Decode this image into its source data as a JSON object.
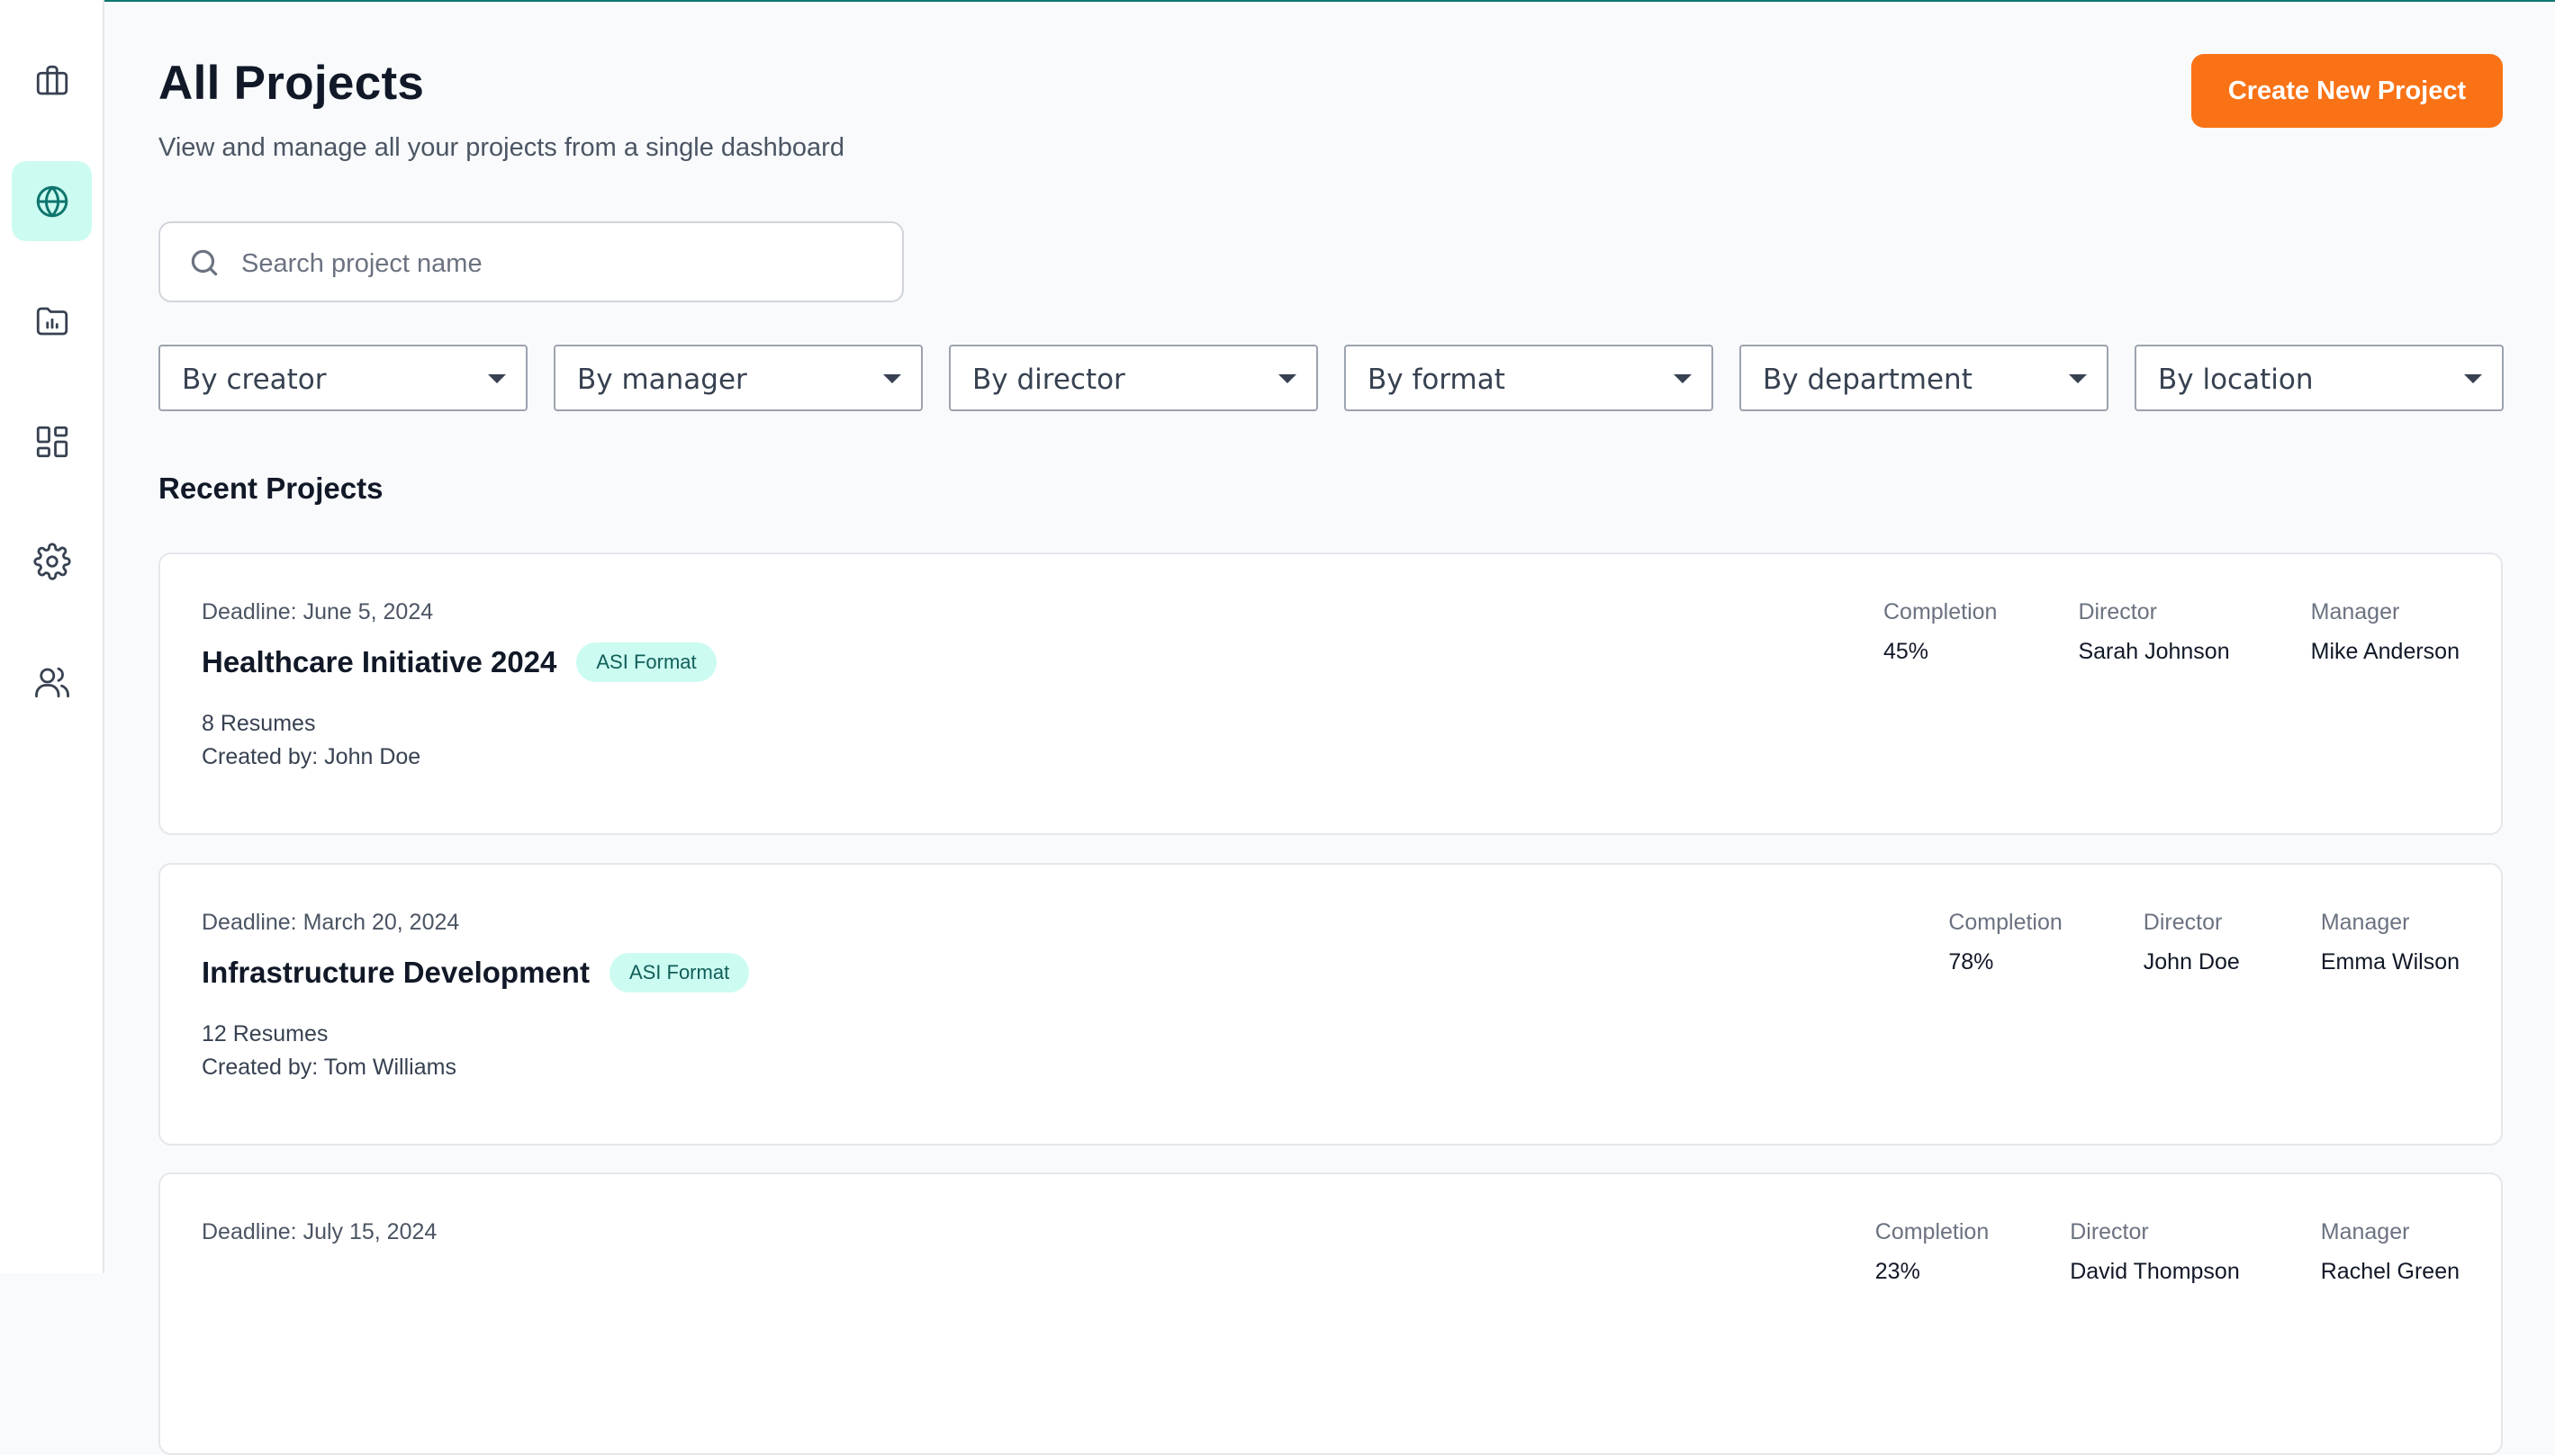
{
  "sidebar": {
    "items": [
      {
        "icon": "briefcase-icon",
        "active": false
      },
      {
        "icon": "globe-icon",
        "active": true
      },
      {
        "icon": "folder-chart-icon",
        "active": false
      },
      {
        "icon": "dashboard-grid-icon",
        "active": false
      },
      {
        "icon": "settings-gear-icon",
        "active": false
      },
      {
        "icon": "users-icon",
        "active": false
      }
    ]
  },
  "header": {
    "title": "All Projects",
    "subtitle": "View and manage all your projects from a single dashboard",
    "create_button": "Create New Project"
  },
  "search": {
    "placeholder": "Search project name",
    "value": ""
  },
  "filters": [
    {
      "label": "By creator"
    },
    {
      "label": "By manager"
    },
    {
      "label": "By director"
    },
    {
      "label": "By format"
    },
    {
      "label": "By department"
    },
    {
      "label": "By location"
    }
  ],
  "section_title": "Recent Projects",
  "projects": [
    {
      "deadline": "Deadline: June 5, 2024",
      "name": "Healthcare Initiative 2024",
      "badge": "ASI Format",
      "resumes": "8 Resumes",
      "created_by": "Created by: John Doe",
      "completion_label": "Completion",
      "completion": "45%",
      "director_label": "Director",
      "director": "Sarah Johnson",
      "manager_label": "Manager",
      "manager": "Mike Anderson"
    },
    {
      "deadline": "Deadline: March 20, 2024",
      "name": "Infrastructure Development",
      "badge": "ASI Format",
      "resumes": "12 Resumes",
      "created_by": "Created by: Tom Williams",
      "completion_label": "Completion",
      "completion": "78%",
      "director_label": "Director",
      "director": "John Doe",
      "manager_label": "Manager",
      "manager": "Emma Wilson"
    },
    {
      "deadline": "Deadline: July 15, 2024",
      "name": "",
      "badge": "",
      "resumes": "",
      "created_by": "",
      "completion_label": "Completion",
      "completion": "23%",
      "director_label": "Director",
      "director": "David Thompson",
      "manager_label": "Manager",
      "manager": "Rachel Green"
    }
  ],
  "colors": {
    "accent": "#f97316",
    "active_nav_bg": "#ccfbf1",
    "brand_teal": "#0f766e",
    "badge_bg": "#ccfbf1"
  }
}
